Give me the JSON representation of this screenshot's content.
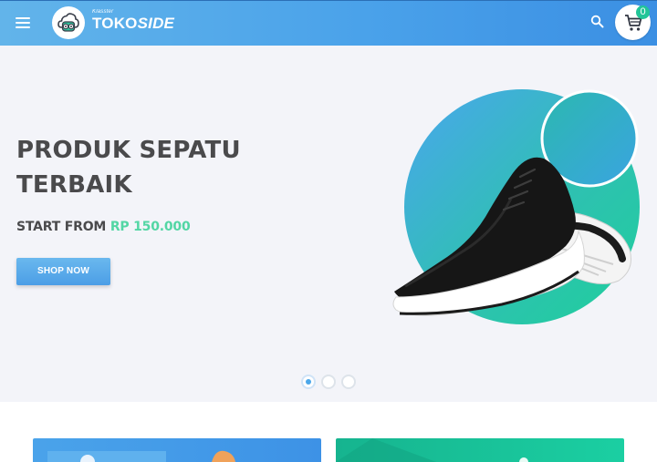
{
  "header": {
    "brand_tagline": "Klasster",
    "brand_name_part1": "TOKO",
    "brand_name_part2": "SIDE",
    "cart_count": "0",
    "colors": {
      "header_start": "#62b4ea",
      "header_end": "#3b8fe3",
      "badge": "#22c598"
    },
    "icons": {
      "menu": "hamburger-icon",
      "search": "search-icon",
      "cart": "cart-icon",
      "logo": "robot-face-logo"
    }
  },
  "hero": {
    "title": "PRODUK SEPATU TERBAIK",
    "price_prefix": "START FROM ",
    "price_value": "RP 150.000",
    "cta_label": "SHOP NOW",
    "slides_total": 3,
    "active_slide": 1,
    "colors": {
      "price": "#52d6a4",
      "cta": "#4b9ee6",
      "background": "#f3f4f9"
    }
  },
  "cards": [
    {
      "color": "#3d92e6"
    },
    {
      "color": "#1bcfa2"
    }
  ]
}
